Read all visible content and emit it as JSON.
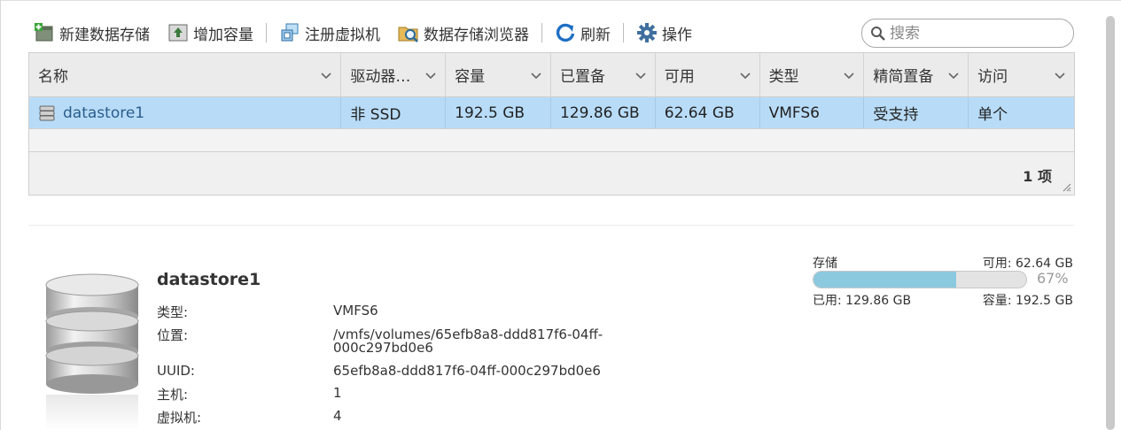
{
  "toolbar": {
    "new_datastore": "新建数据存储",
    "increase_capacity": "增加容量",
    "register_vm": "注册虚拟机",
    "datastore_browser": "数据存储浏览器",
    "refresh": "刷新",
    "actions": "操作"
  },
  "search": {
    "placeholder": "搜索"
  },
  "grid": {
    "columns": [
      "名称",
      "驱动器…",
      "容量",
      "已置备",
      "可用",
      "类型",
      "精简置备",
      "访问"
    ],
    "rows": [
      {
        "name": "datastore1",
        "drive": "非 SSD",
        "capacity": "192.5 GB",
        "provisioned": "129.86 GB",
        "free": "62.64 GB",
        "type": "VMFS6",
        "thin": "受支持",
        "access": "单个"
      }
    ],
    "count": "1 项"
  },
  "detail": {
    "title": "datastore1",
    "labels": {
      "type": "类型:",
      "location": "位置:",
      "uuid": "UUID:",
      "hosts": "主机:",
      "vms": "虚拟机:"
    },
    "values": {
      "type": "VMFS6",
      "location_line1": "/vmfs/volumes/65efb8a8-ddd817f6-04ff-",
      "location_line2": "000c297bd0e6",
      "uuid": "65efb8a8-ddd817f6-04ff-000c297bd0e6",
      "hosts": "1",
      "vms": "4"
    }
  },
  "storage": {
    "label": "存储",
    "free": "可用: 62.64 GB",
    "used": "已用: 129.86 GB",
    "capacity": "容量: 192.5 GB",
    "percent_label": "67%",
    "used_fraction": 0.67,
    "fill_color": "#8bc9de"
  },
  "icons": [
    "new-datastore-icon",
    "increase-capacity-icon",
    "register-vm-icon",
    "datastore-browser-icon",
    "refresh-icon",
    "gear-icon",
    "search-icon",
    "chevron-down-icon",
    "datastore-icon",
    "resize-grip-icon"
  ],
  "colors": {
    "selection": "#b8dcf8",
    "link": "#2b5d8c",
    "header": "#ebebeb"
  }
}
